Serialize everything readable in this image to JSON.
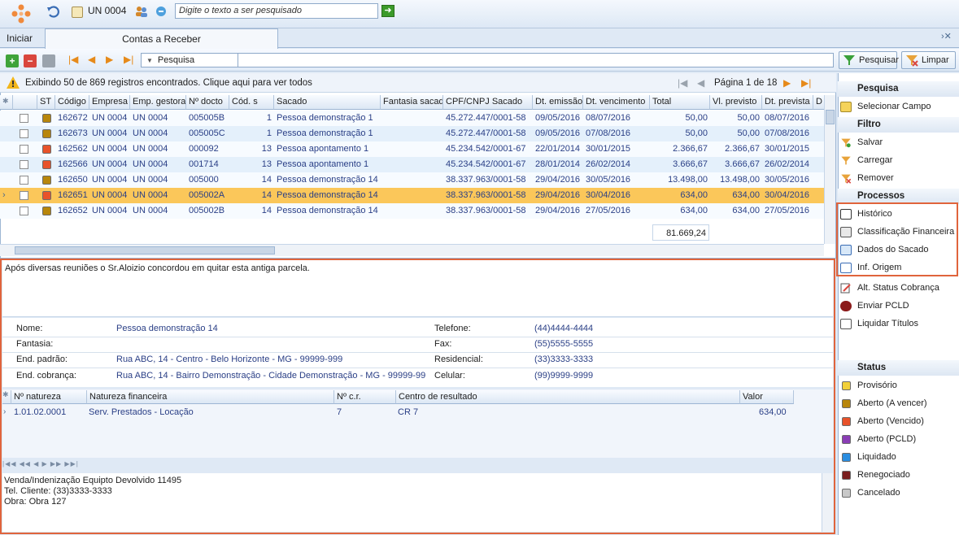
{
  "topbar": {
    "unit_label": "UN 0004",
    "search_placeholder": "Digite o texto a ser pesquisado"
  },
  "tabs": {
    "home": "Iniciar",
    "active": "Contas a Receber"
  },
  "toolbar": {
    "search_combo": "Pesquisa",
    "pesquisar_label": "Pesquisar",
    "limpar_label": "Limpar"
  },
  "info": {
    "message": "Exibindo 50 de 869 registros encontrados. Clique aqui para ver todos",
    "page": "Página 1 de 18"
  },
  "grid": {
    "columns": [
      "ST",
      "Código",
      "Empresa",
      "Emp. gestora",
      "Nº docto",
      "Cód. s",
      "Sacado",
      "Fantasia sacad",
      "CPF/CNPJ Sacado",
      "Dt. emissão",
      "Dt. vencimento",
      "Total",
      "Vl. previsto",
      "Dt. prevista",
      "D"
    ],
    "rows": [
      {
        "st_color": "#b8860b",
        "codigo": "162672",
        "empresa": "UN 0004",
        "gestora": "UN 0004",
        "docto": "005005B",
        "cod": "1",
        "sacado": "Pessoa demonstração 1",
        "fantasia": "",
        "cnpj": "45.272.447/0001-58",
        "emissao": "09/05/2016",
        "vencimento": "08/07/2016",
        "total": "50,00",
        "previsto": "50,00",
        "prevista": "08/07/2016"
      },
      {
        "st_color": "#b8860b",
        "codigo": "162673",
        "empresa": "UN 0004",
        "gestora": "UN 0004",
        "docto": "005005C",
        "cod": "1",
        "sacado": "Pessoa demonstração 1",
        "fantasia": "",
        "cnpj": "45.272.447/0001-58",
        "emissao": "09/05/2016",
        "vencimento": "07/08/2016",
        "total": "50,00",
        "previsto": "50,00",
        "prevista": "07/08/2016"
      },
      {
        "st_color": "#e8522a",
        "codigo": "162562",
        "empresa": "UN 0004",
        "gestora": "UN 0004",
        "docto": "000092",
        "cod": "13",
        "sacado": "Pessoa apontamento 1",
        "fantasia": "",
        "cnpj": "45.234.542/0001-67",
        "emissao": "22/01/2014",
        "vencimento": "30/01/2015",
        "total": "2.366,67",
        "previsto": "2.366,67",
        "prevista": "30/01/2015"
      },
      {
        "st_color": "#e8522a",
        "codigo": "162566",
        "empresa": "UN 0004",
        "gestora": "UN 0004",
        "docto": "001714",
        "cod": "13",
        "sacado": "Pessoa apontamento 1",
        "fantasia": "",
        "cnpj": "45.234.542/0001-67",
        "emissao": "28/01/2014",
        "vencimento": "26/02/2014",
        "total": "3.666,67",
        "previsto": "3.666,67",
        "prevista": "26/02/2014"
      },
      {
        "st_color": "#b8860b",
        "codigo": "162650",
        "empresa": "UN 0004",
        "gestora": "UN 0004",
        "docto": "005000",
        "cod": "14",
        "sacado": "Pessoa demonstração 14",
        "fantasia": "",
        "cnpj": "38.337.963/0001-58",
        "emissao": "29/04/2016",
        "vencimento": "30/05/2016",
        "total": "13.498,00",
        "previsto": "13.498,00",
        "prevista": "30/05/2016"
      },
      {
        "st_color": "#e8522a",
        "codigo": "162651",
        "empresa": "UN 0004",
        "gestora": "UN 0004",
        "docto": "005002A",
        "cod": "14",
        "sacado": "Pessoa demonstração 14",
        "fantasia": "",
        "cnpj": "38.337.963/0001-58",
        "emissao": "29/04/2016",
        "vencimento": "30/04/2016",
        "total": "634,00",
        "previsto": "634,00",
        "prevista": "30/04/2016"
      },
      {
        "st_color": "#b8860b",
        "codigo": "162652",
        "empresa": "UN 0004",
        "gestora": "UN 0004",
        "docto": "005002B",
        "cod": "14",
        "sacado": "Pessoa demonstração 14",
        "fantasia": "",
        "cnpj": "38.337.963/0001-58",
        "emissao": "29/04/2016",
        "vencimento": "27/05/2016",
        "total": "634,00",
        "previsto": "634,00",
        "prevista": "27/05/2016"
      }
    ],
    "selected_row": 5,
    "total_sum": "81.669,24"
  },
  "note": "Após diversas reuniões o Sr.Aloizio concordou em quitar esta antiga parcela.",
  "details": {
    "nome_label": "Nome:",
    "nome": "Pessoa demonstração 14",
    "fantasia_label": "Fantasia:",
    "fantasia": "",
    "end_padrao_label": "End. padrão:",
    "end_padrao": "Rua ABC, 14 - Centro - Belo Horizonte - MG - 99999-999",
    "end_cobranca_label": "End. cobrança:",
    "end_cobranca": "Rua ABC, 14 - Bairro Demonstração - Cidade Demonstração - MG - 99999-99",
    "telefone_label": "Telefone:",
    "telefone": "(44)4444-4444",
    "fax_label": "Fax:",
    "fax": "(55)5555-5555",
    "residencial_label": "Residencial:",
    "residencial": "(33)3333-3333",
    "celular_label": "Celular:",
    "celular": "(99)9999-9999"
  },
  "natureza": {
    "columns": [
      "Nº natureza",
      "Natureza financeira",
      "Nº c.r.",
      "Centro de resultado",
      "Valor"
    ],
    "row": {
      "numero": "1.01.02.0001",
      "natureza": "Serv. Prestados - Locação",
      "cr": "7",
      "centro": "CR 7",
      "valor": "634,00"
    }
  },
  "note2": [
    "Venda/Indenização Equipto Devolvido 11495",
    "Tel. Cliente: (33)3333-3333",
    "Obra: Obra 127"
  ],
  "right_panel": {
    "pesquisa_header": "Pesquisa",
    "selecionar": "Selecionar Campo",
    "filtro_header": "Filtro",
    "salvar": "Salvar",
    "carregar": "Carregar",
    "remover": "Remover",
    "processos_header": "Processos",
    "historico": "Histórico",
    "classificacao": "Classificação Financeira",
    "dados_sacado": "Dados do Sacado",
    "inf_origem": "Inf. Origem",
    "alt_status": "Alt. Status Cobrança",
    "enviar_pcld": "Enviar PCLD",
    "liquidar": "Liquidar Títulos",
    "status_header": "Status",
    "status": [
      {
        "label": "Provisório",
        "color": "#f2d03a"
      },
      {
        "label": "Aberto (A vencer)",
        "color": "#b8860b"
      },
      {
        "label": "Aberto (Vencido)",
        "color": "#e8522a"
      },
      {
        "label": "Aberto (PCLD)",
        "color": "#8a3db5"
      },
      {
        "label": "Liquidado",
        "color": "#2a8de0"
      },
      {
        "label": "Renegociado",
        "color": "#7a1f1f"
      },
      {
        "label": "Cancelado",
        "color": "#c8c8c8"
      }
    ]
  }
}
